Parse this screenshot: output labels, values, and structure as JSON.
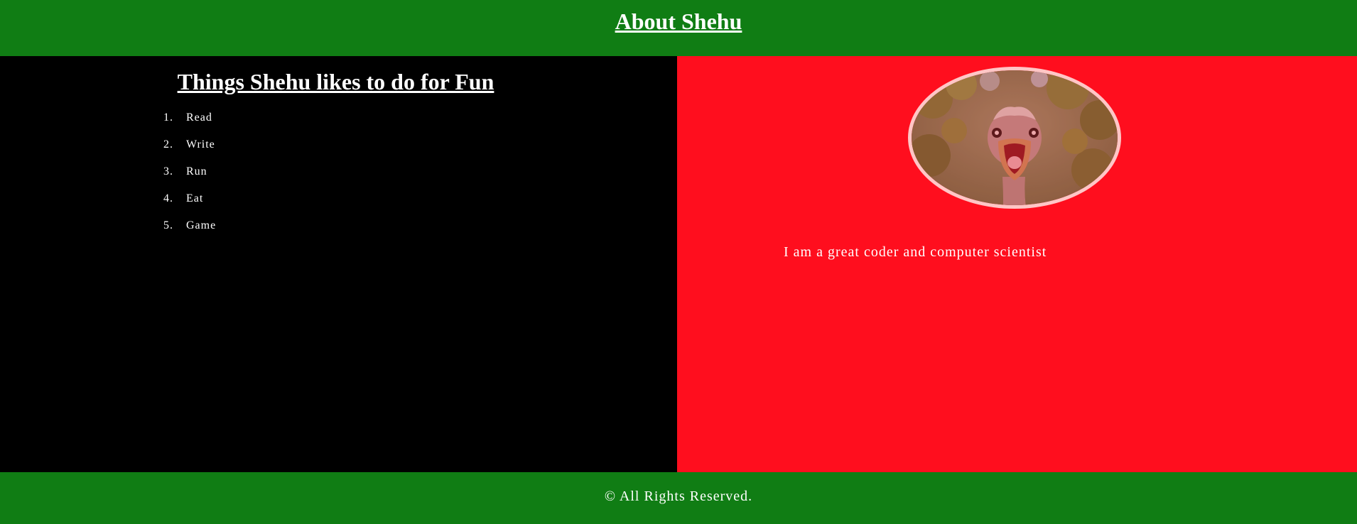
{
  "header": {
    "title": "About Shehu"
  },
  "hobbies": {
    "heading": "Things Shehu likes to do for Fun",
    "items": [
      {
        "num": "1.",
        "label": "Read"
      },
      {
        "num": "2.",
        "label": "Write"
      },
      {
        "num": "3.",
        "label": "Run"
      },
      {
        "num": "4.",
        "label": "Eat"
      },
      {
        "num": "5.",
        "label": "Game"
      }
    ]
  },
  "profile": {
    "image_icon": "ostrich-photo",
    "bio": "I am a great coder and computer scientist"
  },
  "footer": {
    "text": "© All Rights Reserved."
  },
  "colors": {
    "header_bg": "#107d14",
    "left_bg": "#000000",
    "right_bg": "#ff0e1e",
    "avatar_border": "#ffc6c6",
    "text": "#ffffff"
  }
}
